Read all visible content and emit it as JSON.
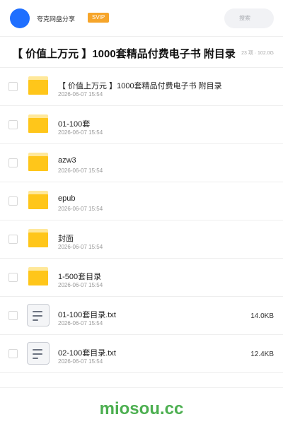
{
  "header": {
    "brand": "夸克网盘分享",
    "badge": "SVIP",
    "search_placeholder": "搜索"
  },
  "title_bar": {
    "title": "【 价值上万元 】1000套精品付费电子书 附目录",
    "stats": "23 项 · 102.0G"
  },
  "files": [
    {
      "name": "【 价值上万元 】1000套精品付费电子书 附目录",
      "date": "2026-06-07 15:54",
      "type": "folder",
      "size": ""
    },
    {
      "name": "01-100套",
      "date": "2026-06-07 15:54",
      "type": "folder",
      "size": ""
    },
    {
      "name": "azw3",
      "date": "2026-06-07 15:54",
      "type": "folder",
      "size": ""
    },
    {
      "name": "epub",
      "date": "2026-06-07 15:54",
      "type": "folder",
      "size": ""
    },
    {
      "name": "封面",
      "date": "2026-06-07 15:54",
      "type": "folder",
      "size": ""
    },
    {
      "name": "1-500套目录",
      "date": "2026-06-07 15:54",
      "type": "folder",
      "size": ""
    },
    {
      "name": "01-100套目录.txt",
      "date": "2026-06-07 15:54",
      "type": "txt",
      "size": "14.0KB"
    },
    {
      "name": "02-100套目录.txt",
      "date": "2026-06-07 15:54",
      "type": "txt",
      "size": "12.4KB"
    }
  ],
  "watermark": "miosou.cc",
  "colors": {
    "avatar": "#1f6fff",
    "badge": "#f6a52a",
    "folder": "#ffc61a",
    "watermark": "#4caf50"
  }
}
